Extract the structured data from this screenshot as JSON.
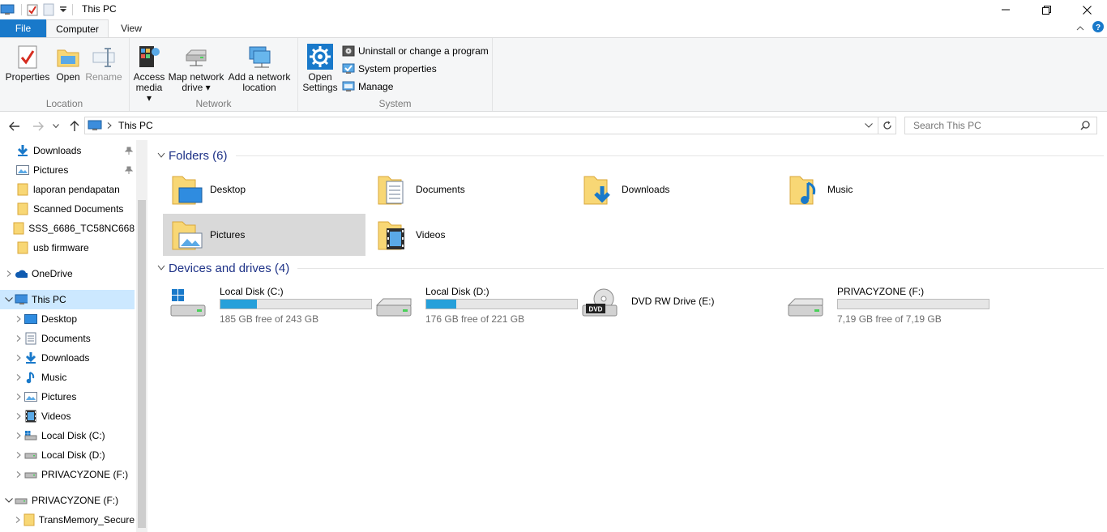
{
  "window": {
    "title": "This PC"
  },
  "tabs": {
    "file": "File",
    "computer": "Computer",
    "view": "View"
  },
  "ribbon": {
    "location": {
      "label": "Location",
      "properties": "Properties",
      "open": "Open",
      "rename": "Rename"
    },
    "network": {
      "label": "Network",
      "access_media": [
        "Access",
        "media ▾"
      ],
      "map_drive": [
        "Map network",
        "drive ▾"
      ],
      "add_location": [
        "Add a network",
        "location"
      ]
    },
    "system": {
      "label": "System",
      "open_settings": [
        "Open",
        "Settings"
      ],
      "uninstall": "Uninstall or change a program",
      "system_properties": "System properties",
      "manage": "Manage"
    }
  },
  "address": {
    "path": "This PC",
    "search_placeholder": "Search This PC"
  },
  "nav": {
    "quick": [
      {
        "label": "Downloads",
        "icon": "download-icon",
        "pinned": true
      },
      {
        "label": "Pictures",
        "icon": "pictures-icon",
        "pinned": true
      },
      {
        "label": "laporan pendapatan",
        "icon": "folder-icon",
        "pinned": false
      },
      {
        "label": "Scanned Documents",
        "icon": "folder-icon",
        "pinned": false
      },
      {
        "label": "SSS_6686_TC58NC668",
        "icon": "folder-icon",
        "pinned": false
      },
      {
        "label": "usb firmware",
        "icon": "folder-icon",
        "pinned": false
      }
    ],
    "onedrive": "OneDrive",
    "thispc": "This PC",
    "pc_children": [
      {
        "label": "Desktop",
        "icon": "desktop-icon"
      },
      {
        "label": "Documents",
        "icon": "documents-icon"
      },
      {
        "label": "Downloads",
        "icon": "download-icon"
      },
      {
        "label": "Music",
        "icon": "music-icon"
      },
      {
        "label": "Pictures",
        "icon": "pictures-icon"
      },
      {
        "label": "Videos",
        "icon": "videos-icon"
      },
      {
        "label": "Local Disk (C:)",
        "icon": "windows-drive-icon"
      },
      {
        "label": "Local Disk (D:)",
        "icon": "drive-icon"
      },
      {
        "label": "PRIVACYZONE (F:)",
        "icon": "drive-icon"
      }
    ],
    "privacyzone": "PRIVACYZONE (F:)",
    "privacy_children": [
      {
        "label": "TransMemory_Secure",
        "icon": "folder-icon"
      }
    ]
  },
  "folders": {
    "header": "Folders (6)",
    "items": [
      {
        "label": "Desktop",
        "icon": "desktop-folder-icon"
      },
      {
        "label": "Documents",
        "icon": "documents-folder-icon"
      },
      {
        "label": "Downloads",
        "icon": "downloads-folder-icon"
      },
      {
        "label": "Music",
        "icon": "music-folder-icon"
      },
      {
        "label": "Pictures",
        "icon": "pictures-folder-icon"
      },
      {
        "label": "Videos",
        "icon": "videos-folder-icon"
      }
    ]
  },
  "drives": {
    "header": "Devices and drives (4)",
    "items": [
      {
        "label": "Local Disk (C:)",
        "free": "185 GB free of 243 GB",
        "used_fraction": 0.24,
        "icon": "windows-drive-icon",
        "has_bar": true
      },
      {
        "label": "Local Disk (D:)",
        "free": "176 GB free of 221 GB",
        "used_fraction": 0.2,
        "icon": "drive-icon",
        "has_bar": true
      },
      {
        "label": "DVD RW Drive (E:)",
        "free": "",
        "used_fraction": 0,
        "icon": "dvd-drive-icon",
        "has_bar": false
      },
      {
        "label": "PRIVACYZONE (F:)",
        "free": "7,19 GB free of 7,19 GB",
        "used_fraction": 0.0,
        "icon": "drive-icon",
        "has_bar": true
      }
    ]
  },
  "colors": {
    "accent": "#1979ca",
    "selection": "#cce8ff",
    "bar": "#26a0da",
    "header_text": "#1e3287"
  }
}
